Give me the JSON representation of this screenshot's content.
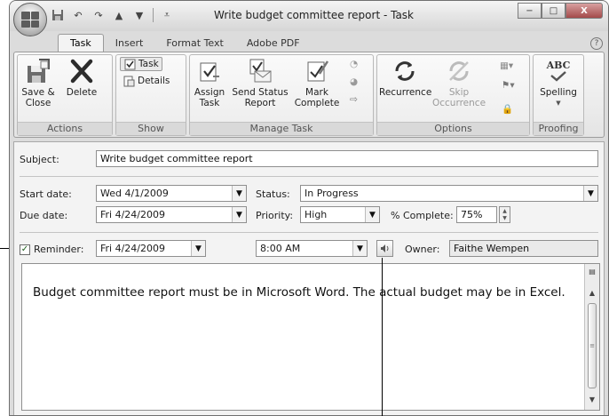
{
  "window": {
    "title": "Write budget committee report - Task",
    "controls": {
      "minimize": "−",
      "maximize": "□",
      "close": "X"
    }
  },
  "tabs": [
    "Task",
    "Insert",
    "Format Text",
    "Adobe PDF"
  ],
  "ribbon": {
    "actions": {
      "label": "Actions",
      "save_close": "Save &\nClose",
      "delete": "Delete"
    },
    "show": {
      "label": "Show",
      "task": "Task",
      "details": "Details"
    },
    "manage_task": {
      "label": "Manage Task",
      "assign": "Assign\nTask",
      "send_status": "Send Status\nReport",
      "mark_complete": "Mark\nComplete"
    },
    "options": {
      "label": "Options",
      "recurrence": "Recurrence",
      "skip": "Skip\nOccurrence"
    },
    "proofing": {
      "label": "Proofing",
      "spelling": "Spelling",
      "abc": "ABC"
    }
  },
  "form": {
    "subject_label": "Subject:",
    "subject_value": "Write budget committee report",
    "start_label": "Start date:",
    "start_value": "Wed 4/1/2009",
    "due_label": "Due date:",
    "due_value": "Fri 4/24/2009",
    "status_label": "Status:",
    "status_value": "In Progress",
    "priority_label": "Priority:",
    "priority_value": "High",
    "complete_label": "% Complete:",
    "complete_value": "75%",
    "reminder_label": "Reminder:",
    "reminder_checked": "✓",
    "reminder_date": "Fri 4/24/2009",
    "reminder_time": "8:00 AM",
    "owner_label": "Owner:",
    "owner_value": "Faithe Wempen",
    "body_text": "Budget committee report must be in Microsoft Word. The actual budget may be in Excel."
  }
}
